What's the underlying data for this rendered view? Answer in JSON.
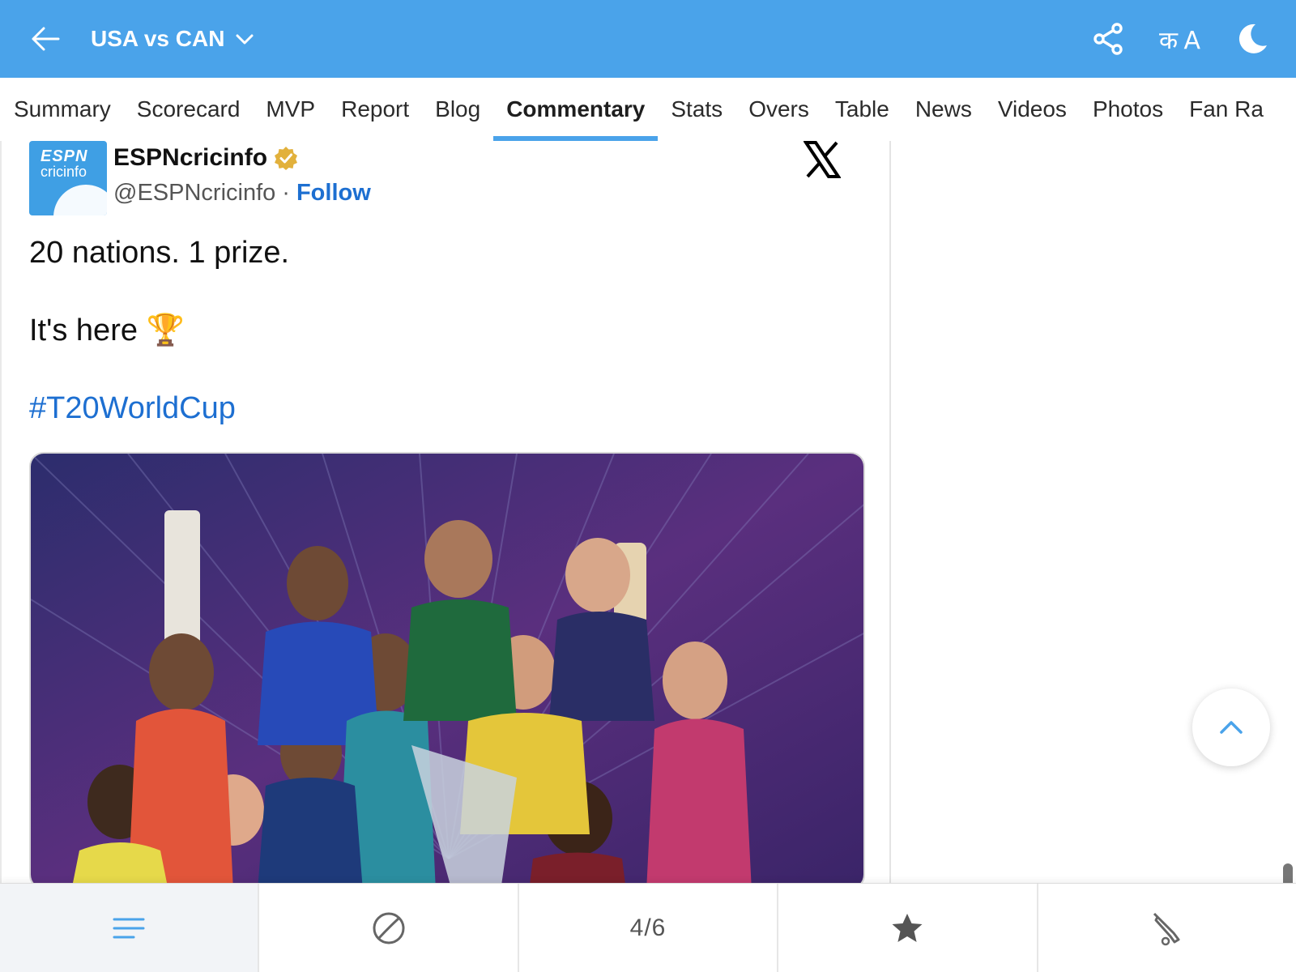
{
  "header": {
    "match_title": "USA vs CAN",
    "background": "#4aa3ea",
    "lang_label": "क A"
  },
  "tabs": [
    {
      "label": "Summary"
    },
    {
      "label": "Scorecard"
    },
    {
      "label": "MVP"
    },
    {
      "label": "Report"
    },
    {
      "label": "Blog"
    },
    {
      "label": "Commentary",
      "active": true
    },
    {
      "label": "Stats"
    },
    {
      "label": "Overs"
    },
    {
      "label": "Table"
    },
    {
      "label": "News"
    },
    {
      "label": "Videos"
    },
    {
      "label": "Photos"
    },
    {
      "label": "Fan Ra"
    }
  ],
  "tweet": {
    "author_name": "ESPNcricinfo",
    "handle": "@ESPNcricinfo",
    "separator": "·",
    "follow_label": "Follow",
    "avatar_line1": "ESPN",
    "avatar_line2": "cricinfo",
    "line1": "20 nations. 1 prize.",
    "line2": "It's here 🏆",
    "hashtag": "#T20WorldCup"
  },
  "bottom_nav": {
    "page_indicator": "4/6",
    "icons": [
      "menu-icon",
      "ball-icon",
      "page-indicator",
      "star-icon",
      "bat-icon"
    ]
  }
}
